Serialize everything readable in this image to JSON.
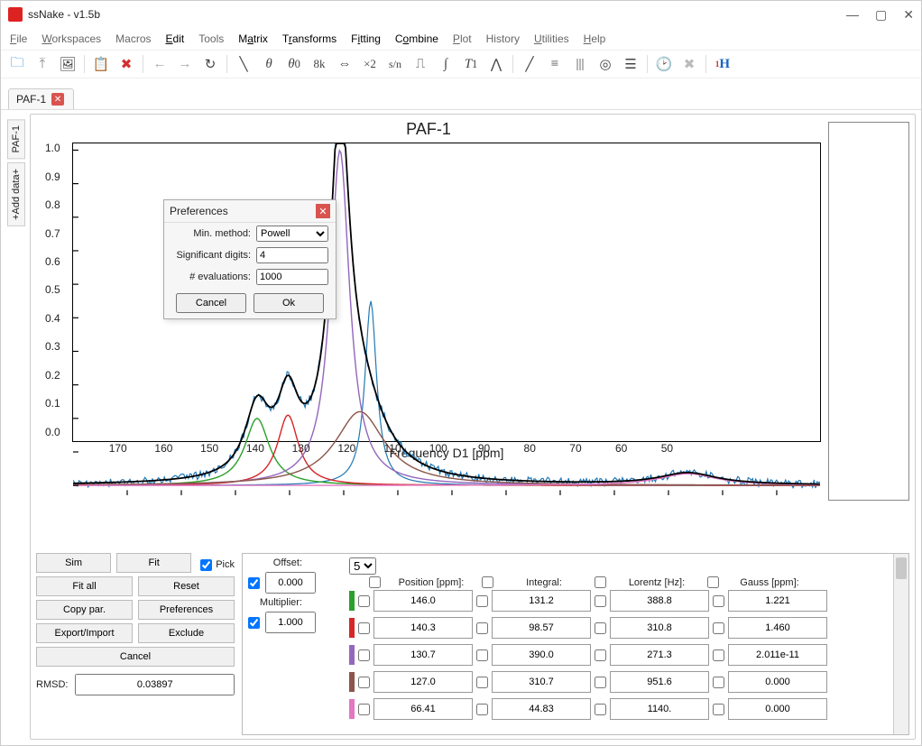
{
  "title": "ssNake - v1.5b",
  "menu": [
    "File",
    "Workspaces",
    "Macros",
    "Edit",
    "Tools",
    "Matrix",
    "Transforms",
    "Fitting",
    "Combine",
    "Plot",
    "History",
    "Utilities",
    "Help"
  ],
  "tab": {
    "label": "PAF-1"
  },
  "sidetabs": [
    "PAF-1",
    "+Add data+"
  ],
  "chart_data": {
    "type": "line",
    "title": "PAF-1",
    "xlabel": "Frequency D1 [ppm]",
    "ylabel": "",
    "xlim": [
      180,
      42
    ],
    "ylim": [
      -0.03,
      1.02
    ],
    "xticks": [
      170,
      160,
      150,
      140,
      130,
      120,
      110,
      100,
      90,
      80,
      70,
      60,
      50
    ],
    "yticks": [
      0.0,
      0.1,
      0.2,
      0.3,
      0.4,
      0.5,
      0.6,
      0.7,
      0.8,
      0.9,
      1.0
    ],
    "series": [
      {
        "name": "data",
        "color": "#1f77b4"
      },
      {
        "name": "fit-total",
        "color": "#000000"
      },
      {
        "name": "site1",
        "color": "#2ca02c"
      },
      {
        "name": "site2",
        "color": "#d62728"
      },
      {
        "name": "site3",
        "color": "#9467bd"
      },
      {
        "name": "site4",
        "color": "#8c564b"
      },
      {
        "name": "site5",
        "color": "#e377c2"
      }
    ],
    "sites": [
      {
        "position": 146.0,
        "integral": 131.2,
        "lorentz": 388.8,
        "gauss": 1.221,
        "color": "#2ca02c",
        "height": 0.2
      },
      {
        "position": 140.3,
        "integral": 98.57,
        "lorentz": 310.8,
        "gauss": 1.46,
        "color": "#d62728",
        "height": 0.21
      },
      {
        "position": 130.7,
        "integral": 390.0,
        "lorentz": 271.3,
        "gauss": 2.011e-11,
        "color": "#9467bd",
        "height": 1.0
      },
      {
        "position": 127.0,
        "integral": 310.7,
        "lorentz": 951.6,
        "gauss": 0.0,
        "color": "#8c564b",
        "height": 0.22
      },
      {
        "position": 66.41,
        "integral": 44.83,
        "lorentz": 1140.0,
        "gauss": 0.0,
        "color": "#e377c2",
        "height": 0.035
      }
    ]
  },
  "dialog": {
    "title": "Preferences",
    "min_method_label": "Min. method:",
    "min_method_value": "Powell",
    "sig_digits_label": "Significant digits:",
    "sig_digits_value": "4",
    "evals_label": "# evaluations:",
    "evals_value": "1000",
    "cancel": "Cancel",
    "ok": "Ok"
  },
  "controls": {
    "buttons": [
      "Sim",
      "Fit",
      "Fit all",
      "Reset",
      "Copy par.",
      "Preferences",
      "Export/Import",
      "Exclude",
      "Cancel"
    ],
    "pick_label": "Pick",
    "rmsd_label": "RMSD:",
    "rmsd_value": "0.03897"
  },
  "fit": {
    "offset_label": "Offset:",
    "offset_sel": "5",
    "offset_val": "0.000",
    "multiplier_label": "Multiplier:",
    "multiplier_val": "1.000",
    "headers": [
      "Position [ppm]:",
      "Integral:",
      "Lorentz [Hz]:",
      "Gauss [ppm]:"
    ],
    "rows": [
      {
        "color": "#2ca02c",
        "position": "146.0",
        "integral": "131.2",
        "lorentz": "388.8",
        "gauss": "1.221"
      },
      {
        "color": "#d62728",
        "position": "140.3",
        "integral": "98.57",
        "lorentz": "310.8",
        "gauss": "1.460"
      },
      {
        "color": "#9467bd",
        "position": "130.7",
        "integral": "390.0",
        "lorentz": "271.3",
        "gauss": "2.011e-11"
      },
      {
        "color": "#8c564b",
        "position": "127.0",
        "integral": "310.7",
        "lorentz": "951.6",
        "gauss": "0.000"
      },
      {
        "color": "#e377c2",
        "position": "66.41",
        "integral": "44.83",
        "lorentz": "1140.",
        "gauss": "0.000"
      }
    ]
  }
}
